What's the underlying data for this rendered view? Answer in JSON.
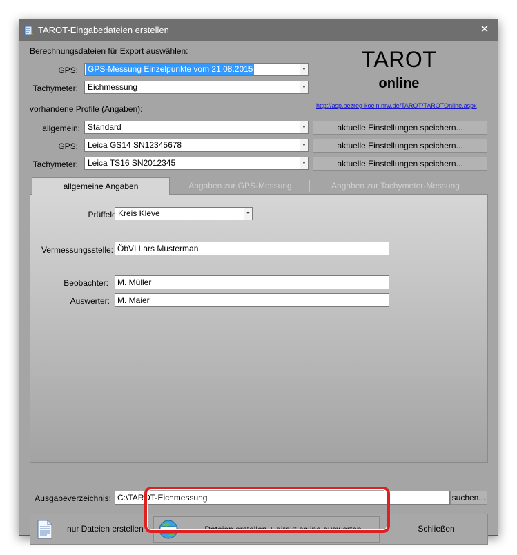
{
  "window": {
    "title": "TAROT-Eingabedateien erstellen",
    "close_glyph": "✕"
  },
  "export": {
    "heading": "Berechnungsdateien für Export auswählen:",
    "gps_label": "GPS:",
    "gps_value": "GPS-Messung Einzelpunkte vom 21.08.2015",
    "tachy_label": "Tachymeter:",
    "tachy_value": "Eichmessung"
  },
  "brand": {
    "title": "TAROT",
    "subtitle": "online",
    "url": "http://asp.bezreg-koeln.nrw.de/TAROT/TAROTOnline.aspx"
  },
  "profiles": {
    "heading": "vorhandene Profile (Angaben):",
    "rows": [
      {
        "label": "allgemein:",
        "value": "Standard",
        "button": "aktuelle Einstellungen speichern..."
      },
      {
        "label": "GPS:",
        "value": "Leica GS14 SN12345678",
        "button": "aktuelle Einstellungen speichern..."
      },
      {
        "label": "Tachymeter:",
        "value": "Leica TS16 SN2012345",
        "button": "aktuelle Einstellungen speichern..."
      }
    ]
  },
  "tabs": [
    {
      "label": "allgemeine Angaben",
      "active": true
    },
    {
      "label": "Angaben zur GPS-Messung",
      "active": false
    },
    {
      "label": "Angaben zur Tachymeter-Messung",
      "active": false
    }
  ],
  "general": {
    "prueffeld_label": "Prüffeld:",
    "prueffeld_value": "Kreis Kleve",
    "vermessungsstelle_label": "Vermessungsstelle:",
    "vermessungsstelle_value": "ÖbVI Lars Musterman",
    "beobachter_label": "Beobachter:",
    "beobachter_value": "M. Müller",
    "auswerter_label": "Auswerter:",
    "auswerter_value": "M. Maier"
  },
  "output": {
    "label": "Ausgabeverzeichnis:",
    "value": "C:\\TAROT-Eichmessung",
    "browse": "suchen..."
  },
  "actions": {
    "files_only": "nur Dateien erstellen",
    "files_online": "Dateien erstellen + direkt online auswerten",
    "close": "Schließen",
    "www_badge": "www"
  },
  "colors": {
    "highlight": "#e02020",
    "selection": "#3399ff",
    "link": "#1515d0"
  }
}
